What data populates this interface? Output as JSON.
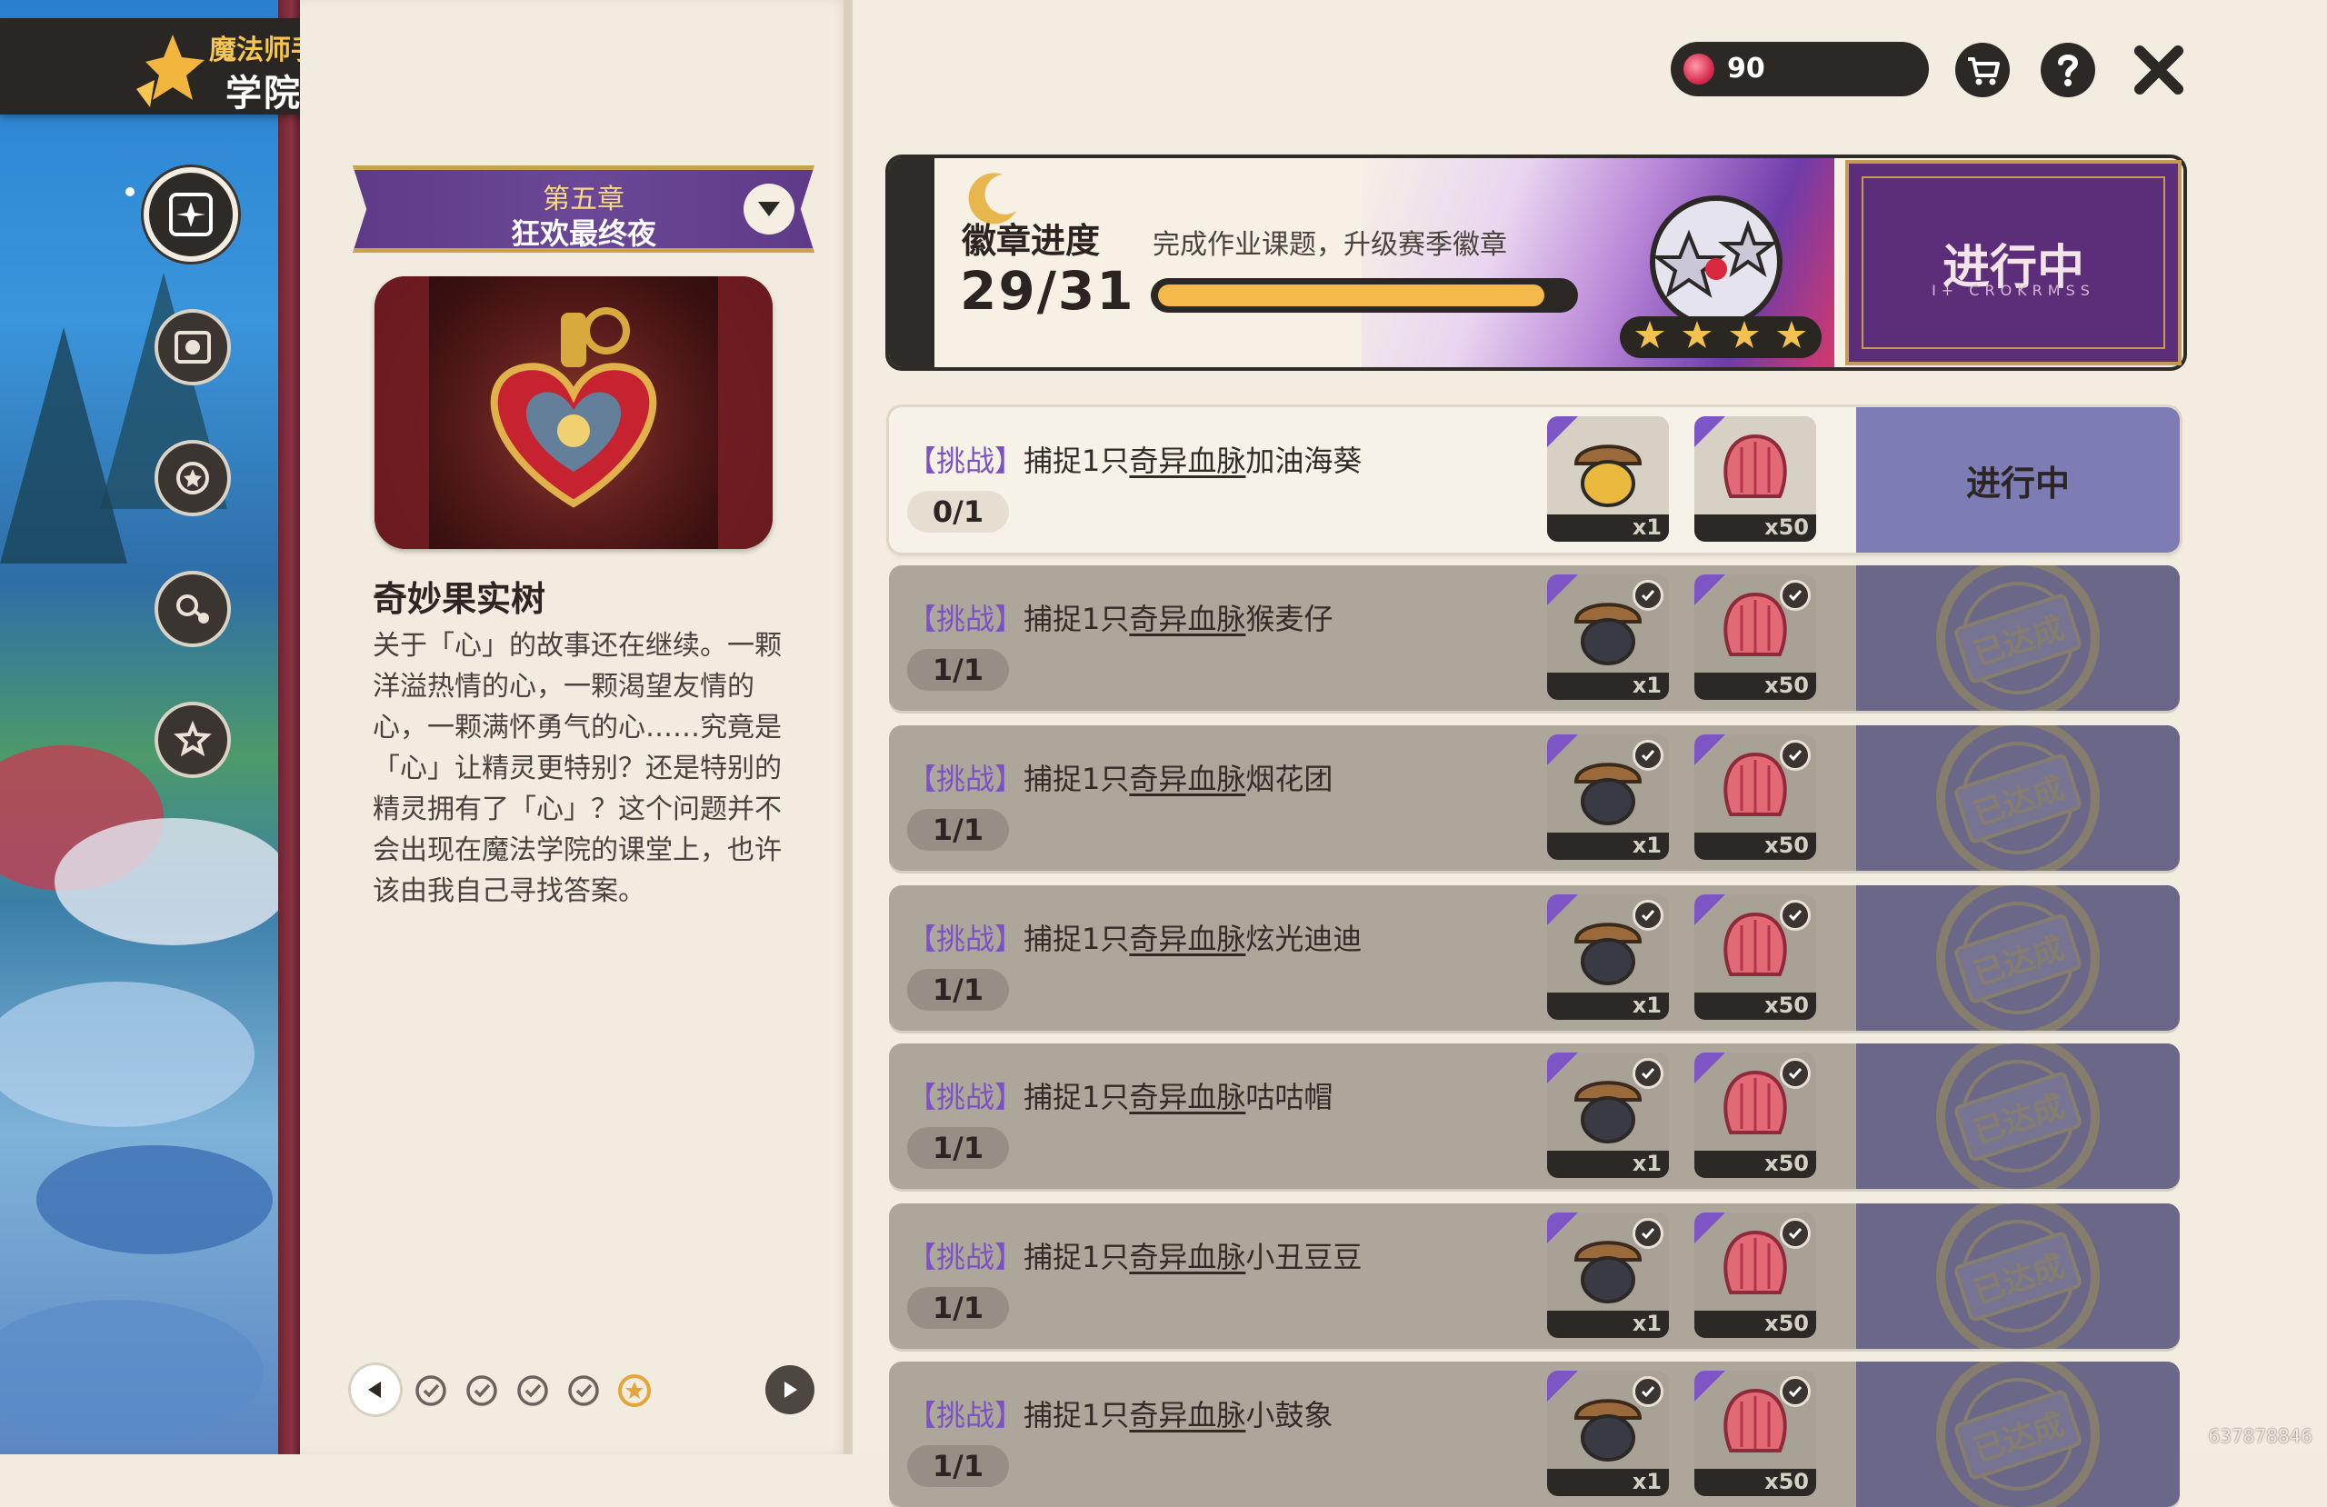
{
  "header": {
    "subtitle": "魔法师手册",
    "title": "学院作业"
  },
  "currency": {
    "icon": "gem-icon",
    "amount": "90"
  },
  "toolbar": {
    "shop_icon": "cart-icon",
    "help_icon": "question-icon",
    "close_icon": "close-icon"
  },
  "nav": [
    {
      "icon": "compass-book-icon",
      "active": true
    },
    {
      "icon": "fist-scroll-icon",
      "active": false
    },
    {
      "icon": "star-moon-icon",
      "active": false
    },
    {
      "icon": "star-molecule-icon",
      "active": false
    },
    {
      "icon": "star-hourglass-icon",
      "active": false
    }
  ],
  "chapter": {
    "number": "第五章",
    "name": "狂欢最终夜"
  },
  "story": {
    "title": "奇妙果实树",
    "paragraph": "关于「心」的故事还在继续。一颗洋溢热情的心，一颗渴望友情的心，一颗满怀勇气的心……究竟是「心」让精灵更特别？还是特别的精灵拥有了「心」？这个问题并不会出现在魔法学院的课堂上，也许该由我自己寻找答案。"
  },
  "pager": {
    "dots": [
      "done",
      "done",
      "done",
      "done",
      "current"
    ]
  },
  "badge": {
    "title": "徽章进度",
    "subtitle": "完成作业课题，升级赛季徽章",
    "current": 29,
    "total": 31,
    "count_text": "29/31",
    "stars": 4,
    "status": "进行中",
    "status_sub": "I+ CROKRMSS"
  },
  "tasks": [
    {
      "tag": "【挑战】",
      "prefix": "捕捉1只",
      "keyword": "奇异血脉",
      "target": "加油海葵",
      "progress": "0/1",
      "done": false,
      "status": "进行中",
      "rewards": [
        {
          "qty": "x1",
          "icon": "acorn-yellow-icon"
        },
        {
          "qty": "x50",
          "icon": "pink-shell-icon"
        }
      ]
    },
    {
      "tag": "【挑战】",
      "prefix": "捕捉1只",
      "keyword": "奇异血脉",
      "target": "猴麦仔",
      "progress": "1/1",
      "done": true,
      "status": "已达成",
      "rewards": [
        {
          "qty": "x1",
          "icon": "acorn-dark-icon"
        },
        {
          "qty": "x50",
          "icon": "pink-shell-icon"
        }
      ]
    },
    {
      "tag": "【挑战】",
      "prefix": "捕捉1只",
      "keyword": "奇异血脉",
      "target": "烟花团",
      "progress": "1/1",
      "done": true,
      "status": "已达成",
      "rewards": [
        {
          "qty": "x1",
          "icon": "acorn-grey-icon"
        },
        {
          "qty": "x50",
          "icon": "pink-shell-icon"
        }
      ]
    },
    {
      "tag": "【挑战】",
      "prefix": "捕捉1只",
      "keyword": "奇异血脉",
      "target": "炫光迪迪",
      "progress": "1/1",
      "done": true,
      "status": "已达成",
      "rewards": [
        {
          "qty": "x1",
          "icon": "acorn-gold-icon"
        },
        {
          "qty": "x50",
          "icon": "pink-shell-icon"
        }
      ]
    },
    {
      "tag": "【挑战】",
      "prefix": "捕捉1只",
      "keyword": "奇异血脉",
      "target": "咕咕帽",
      "progress": "1/1",
      "done": true,
      "status": "已达成",
      "rewards": [
        {
          "qty": "x1",
          "icon": "acorn-bow-icon"
        },
        {
          "qty": "x50",
          "icon": "pink-shell-icon"
        }
      ]
    },
    {
      "tag": "【挑战】",
      "prefix": "捕捉1只",
      "keyword": "奇异血脉",
      "target": "小丑豆豆",
      "progress": "1/1",
      "done": true,
      "status": "已达成",
      "rewards": [
        {
          "qty": "x1",
          "icon": "acorn-purple-icon"
        },
        {
          "qty": "x50",
          "icon": "pink-shell-icon"
        }
      ]
    },
    {
      "tag": "【挑战】",
      "prefix": "捕捉1只",
      "keyword": "奇异血脉",
      "target": "小鼓象",
      "progress": "1/1",
      "done": true,
      "status": "已达成",
      "rewards": [
        {
          "qty": "x1",
          "icon": "acorn-blue-icon"
        },
        {
          "qty": "x50",
          "icon": "pink-shell-icon"
        }
      ]
    }
  ],
  "uid": "637878846",
  "colors": {
    "accent_purple": "#7b52c6",
    "progress_fill": "#f4b84b",
    "panel_dark": "#2c2825",
    "status_active": "#7e7cb4",
    "status_done": "#6b6789"
  }
}
